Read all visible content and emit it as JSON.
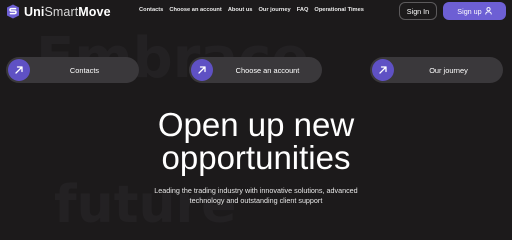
{
  "brand": {
    "name_part1": "Uni",
    "name_part2": "Smart",
    "name_part3": "Move",
    "logo_icon": "s-shield-logo-icon"
  },
  "nav": {
    "items": [
      {
        "label": "Contacts"
      },
      {
        "label": "Choose an account"
      },
      {
        "label": "About us"
      },
      {
        "label": "Our journey"
      },
      {
        "label": "FAQ"
      },
      {
        "label": "Operational Times"
      }
    ]
  },
  "auth": {
    "sign_in_label": "Sign In",
    "sign_up_label": "Sign up",
    "sign_up_icon": "user-icon"
  },
  "background_watermark": {
    "line1": "Embrace",
    "line2": "future"
  },
  "quick_links": [
    {
      "label": "Contacts",
      "icon": "arrow-up-right-icon"
    },
    {
      "label": "Choose an account",
      "icon": "arrow-up-right-icon"
    },
    {
      "label": "Our journey",
      "icon": "arrow-up-right-icon"
    }
  ],
  "hero": {
    "title_line1": "Open up new",
    "title_line2": "opportunities",
    "subtitle_line1": "Leading the trading industry with innovative solutions, advanced",
    "subtitle_line2": "technology and outstanding client support"
  },
  "colors": {
    "background": "#1c1a1b",
    "accent": "#6d5fd4",
    "pill": "#3a383b",
    "text": "#ffffff"
  }
}
